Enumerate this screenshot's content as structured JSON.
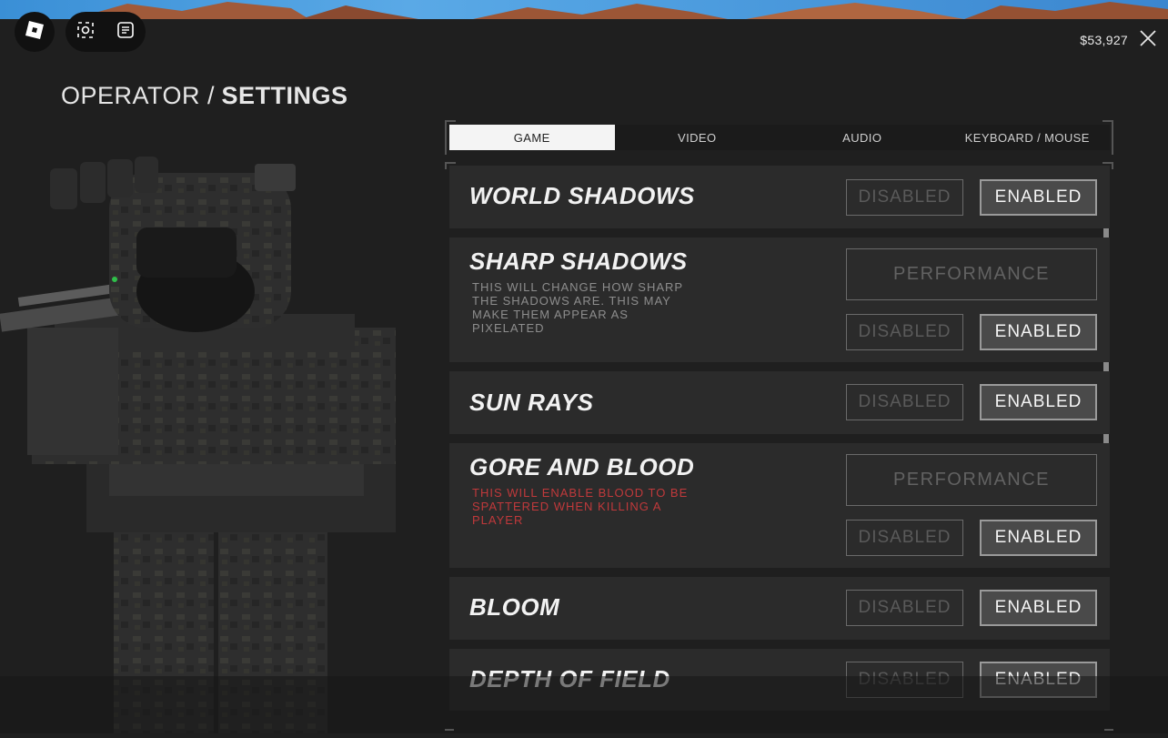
{
  "header": {
    "money": "$53,927",
    "breadcrumb": "OPERATOR /",
    "title": "SETTINGS"
  },
  "tabs": [
    {
      "label": "GAME",
      "active": true
    },
    {
      "label": "VIDEO",
      "active": false
    },
    {
      "label": "AUDIO",
      "active": false
    },
    {
      "label": "KEYBOARD / MOUSE",
      "active": false
    }
  ],
  "settings": [
    {
      "title": "WORLD SHADOWS",
      "disabled": "DISABLED",
      "enabled": "ENABLED",
      "selected": "enabled"
    },
    {
      "title": "SHARP SHADOWS",
      "description": "THIS WILL CHANGE HOW SHARP THE SHADOWS ARE. THIS MAY MAKE THEM APPEAR AS PIXELATED",
      "performance": "PERFORMANCE",
      "disabled": "DISABLED",
      "enabled": "ENABLED",
      "selected": "enabled"
    },
    {
      "title": "SUN RAYS",
      "disabled": "DISABLED",
      "enabled": "ENABLED",
      "selected": "enabled"
    },
    {
      "title": "GORE AND BLOOD",
      "description": "THIS WILL ENABLE BLOOD TO BE SPATTERED WHEN KILLING A PLAYER",
      "performance": "PERFORMANCE",
      "disabled": "DISABLED",
      "enabled": "ENABLED",
      "selected": "enabled"
    },
    {
      "title": "BLOOM",
      "disabled": "DISABLED",
      "enabled": "ENABLED",
      "selected": "enabled"
    },
    {
      "title": "DEPTH OF FIELD",
      "disabled": "DISABLED",
      "enabled": "ENABLED",
      "selected": "enabled"
    }
  ],
  "icons": {
    "roblox_menu": "roblox-logo-icon",
    "capture": "capture-icon",
    "chat": "chat-icon",
    "close": "close-icon"
  },
  "colors": {
    "background": "#1f1f1f",
    "row": "#2b2b2b",
    "selected": "#4a4a4a",
    "gore_desc": "#c0393b"
  }
}
